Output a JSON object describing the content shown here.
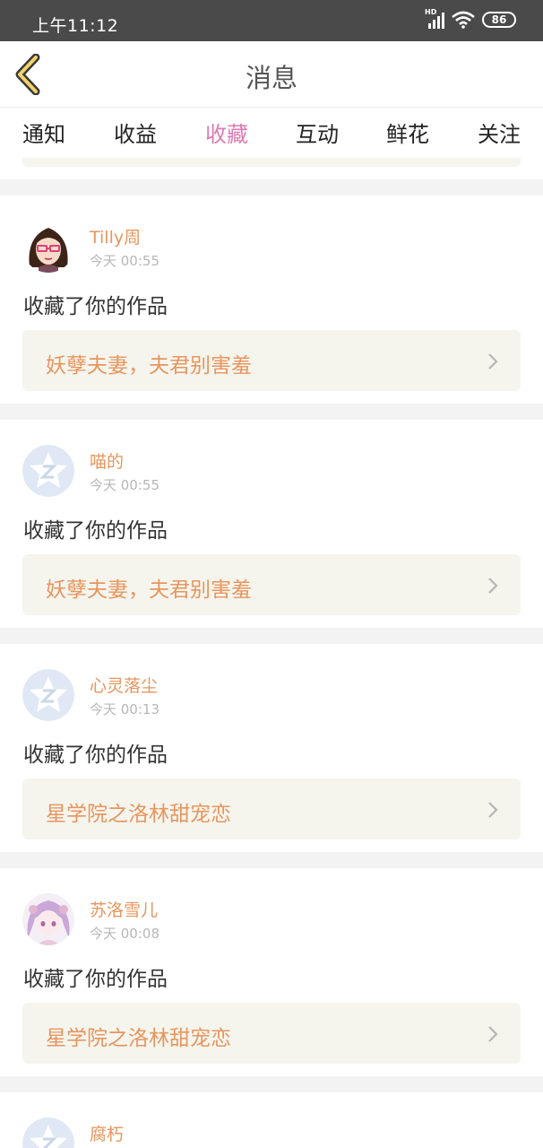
{
  "status_bar": {
    "time": "上午11:12",
    "network": "HD",
    "battery": "86"
  },
  "header": {
    "title": "消息",
    "back_icon": "chevron-left-icon"
  },
  "tabs": [
    {
      "label": "通知",
      "active": false
    },
    {
      "label": "收益",
      "active": false
    },
    {
      "label": "收藏",
      "active": true
    },
    {
      "label": "互动",
      "active": false
    },
    {
      "label": "鲜花",
      "active": false
    },
    {
      "label": "关注",
      "active": false
    }
  ],
  "colors": {
    "accent": "#e07ab2",
    "name": "#e8955e",
    "card": "#f5f5ee",
    "separator": "#f3f3f3"
  },
  "messages": [
    {
      "user": "Tilly周",
      "time": "今天 00:55",
      "action": "收藏了你的作品",
      "work": "妖孽夫妻，夫君别害羞",
      "avatar": "girl-avatar"
    },
    {
      "user": "喵的",
      "time": "今天 00:55",
      "action": "收藏了你的作品",
      "work": "妖孽夫妻，夫君别害羞",
      "avatar": "default-avatar"
    },
    {
      "user": "心灵落尘",
      "time": "今天 00:13",
      "action": "收藏了你的作品",
      "work": "星学院之洛林甜宠恋",
      "avatar": "default-avatar"
    },
    {
      "user": "苏洛雪儿",
      "time": "今天 00:08",
      "action": "收藏了你的作品",
      "work": "星学院之洛林甜宠恋",
      "avatar": "anime-avatar"
    },
    {
      "user": "腐朽",
      "avatar": "default-avatar"
    }
  ]
}
